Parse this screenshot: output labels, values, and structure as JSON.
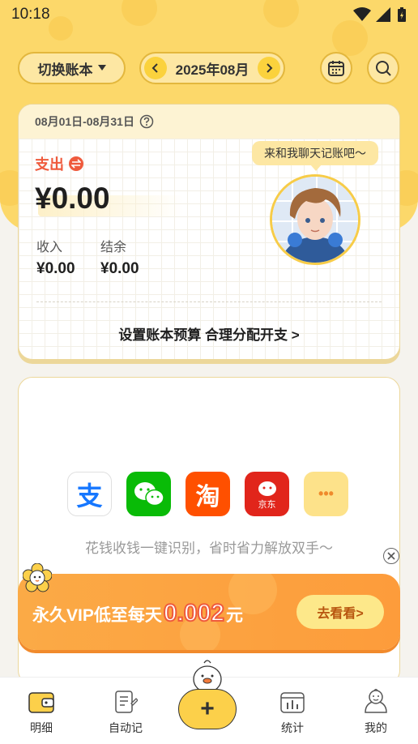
{
  "status_bar": {
    "time": "10:18"
  },
  "header": {
    "switch_book_label": "切换账本",
    "month_label": "2025年08月"
  },
  "summary": {
    "date_range": "08月01日-08月31日",
    "expense_label": "支出",
    "expense_amount": "¥0.00",
    "income_label": "收入",
    "income_amount": "¥0.00",
    "balance_label": "结余",
    "balance_amount": "¥0.00",
    "budget_link": "设置账本预算 合理分配开支 >",
    "chat_bubble": "来和我聊天记账吧～"
  },
  "import": {
    "apps": [
      {
        "name": "alipay-icon",
        "glyph": "支",
        "color": "#1677ff"
      },
      {
        "name": "wechat-icon",
        "glyph": "",
        "color": "#09bb07"
      },
      {
        "name": "taobao-icon",
        "glyph": "淘",
        "color": "#ff5000"
      },
      {
        "name": "jd-icon",
        "glyph": "京东",
        "color": "#e1251b"
      },
      {
        "name": "more-icon",
        "glyph": "•••",
        "color": "#fde28a"
      }
    ],
    "description": "花钱收钱一键识别，省时省力解放双手～"
  },
  "vip_banner": {
    "text_prefix": "永久VIP低至每天",
    "price": "0.002",
    "unit": "元",
    "button_label": "去看看>"
  },
  "tabbar": {
    "details": "明细",
    "auto": "自动记",
    "stats": "统计",
    "mine": "我的",
    "add": "+"
  }
}
